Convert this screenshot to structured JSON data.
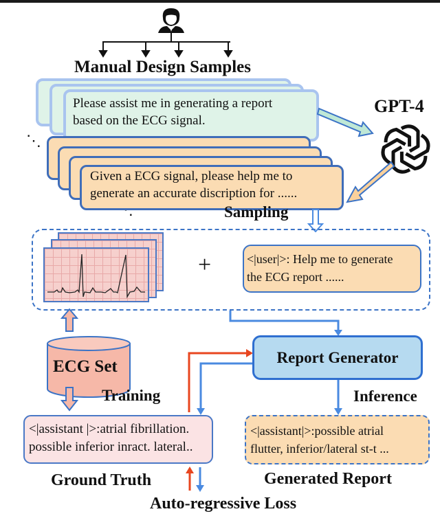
{
  "labels": {
    "manual_design_samples": "Manual Design Samples",
    "gpt4": "GPT-4",
    "sampling": "Sampling",
    "ecg_set": "ECG Set",
    "training": "Training",
    "inference": "Inference",
    "report_generator": "Report Generator",
    "ground_truth": "Ground Truth",
    "generated_report": "Generated Report",
    "auto_regressive_loss": "Auto-regressive Loss",
    "plus": "+",
    "ellipsis_top": "⋱",
    "ellipsis_bottom": "⋱"
  },
  "manual_sample": {
    "line1": "Please assist me in generating a report",
    "line2": "based on the ECG signal."
  },
  "gpt_sample": {
    "line1": "Given a ECG signal, please help me to",
    "line2": "generate an accurate discription for ......"
  },
  "user_prompt": {
    "line1": "<|user|>: Help me to generate",
    "line2": "the ECG report ......"
  },
  "ground_truth_text": {
    "line1": "<|assistant |>:atrial fibrillation.",
    "line2": "possible inferior inract. lateral.."
  },
  "generated_report_text": {
    "line1": "<|assistant|>:possible atrial",
    "line2": "flutter, inferior/lateral st-t ..."
  },
  "colors": {
    "training_arrow": "#e8461f",
    "flow_arrow": "#4a8ae0",
    "green_card": "#dff3e8",
    "orange_card": "#fbdcb3",
    "report_generator": "#b6daf0",
    "ecg_set": "#f6b8a8"
  }
}
